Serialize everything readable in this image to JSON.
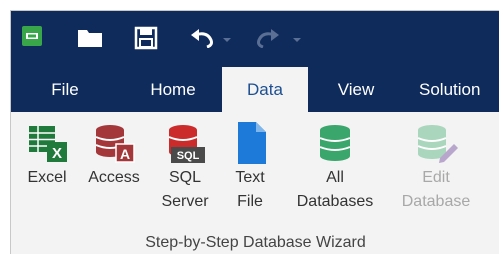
{
  "menu": {
    "items": [
      "File",
      "Home",
      "Data",
      "View",
      "Solution"
    ]
  },
  "ribbon": {
    "buttons": {
      "excel": [
        "Excel"
      ],
      "access": [
        "Access"
      ],
      "sql": [
        "SQL",
        "Server"
      ],
      "text": [
        "Text",
        "File"
      ],
      "all": [
        "All",
        "Databases"
      ],
      "edit": [
        "Edit",
        "Database"
      ]
    },
    "group_label": "Step-by-Step Database Wizard"
  },
  "icons": {
    "quick_access": [
      "app-icon",
      "folder-icon",
      "save-icon",
      "undo-icon",
      "redo-icon"
    ],
    "ribbon": [
      "excel-icon",
      "access-icon",
      "sql-server-icon",
      "text-file-icon",
      "all-databases-icon",
      "edit-database-icon"
    ]
  },
  "colors": {
    "titlebar": "#0e2b5c",
    "active_tab_text": "#1d4f91",
    "excel": "#1f7a3c",
    "access": "#a4373a",
    "sql": "#cc2b2b",
    "text_file": "#1e7ad9",
    "all_db": "#3aa66b",
    "disabled": "#a8a8a8"
  }
}
